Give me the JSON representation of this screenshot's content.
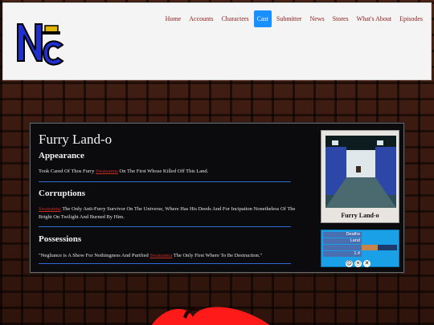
{
  "header": {
    "logo_text": "NC",
    "nav": [
      {
        "label": "Home",
        "active": false
      },
      {
        "label": "Accounts",
        "active": false
      },
      {
        "label": "Characters",
        "active": false
      },
      {
        "label": "Cast",
        "active": true
      },
      {
        "label": "Submitter",
        "active": false
      },
      {
        "label": "News",
        "active": false
      },
      {
        "label": "Stores",
        "active": false
      },
      {
        "label": "What's About",
        "active": false
      },
      {
        "label": "Episodes",
        "active": false
      }
    ]
  },
  "page": {
    "title": "Furry Land-o",
    "sections": [
      {
        "heading": "Appearance",
        "text_before": "Took Cared Of Thos Furry ",
        "link": "Swatsanna",
        "text_after": " On The First Whose Killed Off This Land."
      },
      {
        "heading": "Corruptions",
        "text_before": "",
        "link": "Swatsanna",
        "text_after": " The Only Anti-Furry Survivor On The Universe, Where Has His Deeds And For Incipation Nonetheless Of The Bright On Twilight And Burned By Him."
      },
      {
        "heading": "Possessions",
        "text_before": "\"Negliance is A Show For Nothingness And Purified ",
        "link": "Swatsanna",
        "text_after": " The Only First Where To Be Destruction.\""
      }
    ]
  },
  "card": {
    "caption": "Furry Land-o"
  },
  "stats": {
    "rows": [
      {
        "label": "Deaths",
        "fill": 0
      },
      {
        "label": "Land",
        "fill": 0
      },
      {
        "label": "",
        "fill": 0.45
      },
      {
        "label": "1.4",
        "fill": 0
      }
    ],
    "icons": [
      "smiley-icon",
      "w-icon",
      "x-icon"
    ]
  },
  "colors": {
    "accent": "#1a8fff",
    "link": "#c62b1f",
    "rule": "#2c6bd6",
    "stats_bg": "#1aa0e6"
  }
}
